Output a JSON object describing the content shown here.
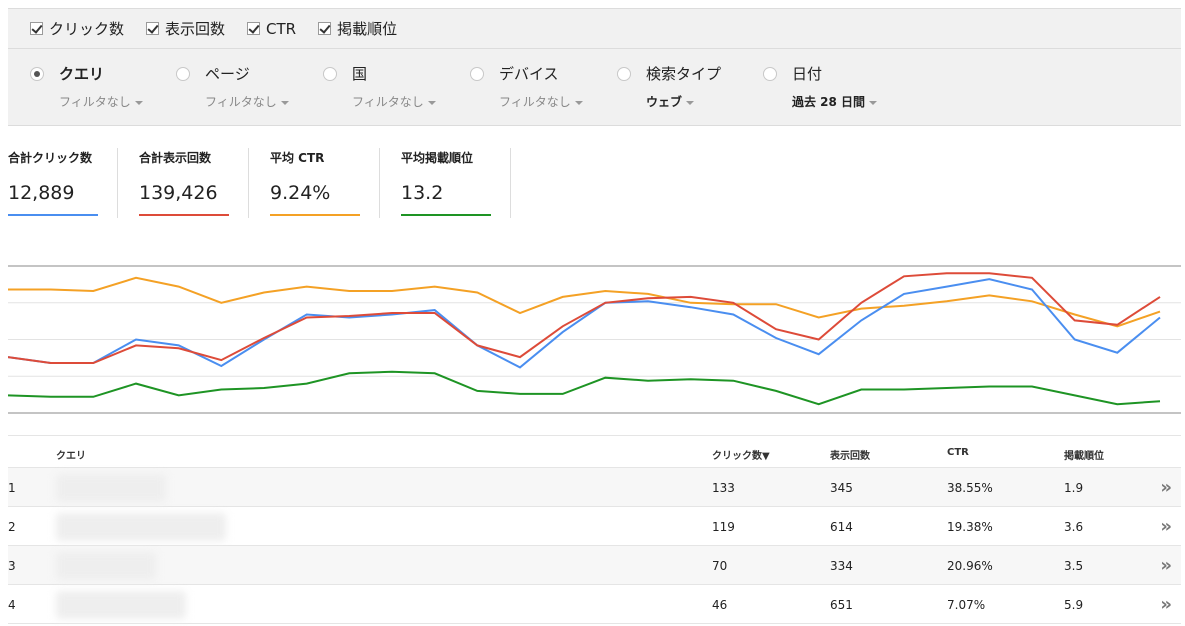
{
  "metric_toggles": [
    {
      "label": "クリック数",
      "checked": true
    },
    {
      "label": "表示回数",
      "checked": true
    },
    {
      "label": "CTR",
      "checked": true
    },
    {
      "label": "掲載順位",
      "checked": true
    }
  ],
  "groups": [
    {
      "label": "クエリ",
      "sub": "フィルタなし",
      "selected": true
    },
    {
      "label": "ページ",
      "sub": "フィルタなし",
      "selected": false
    },
    {
      "label": "国",
      "sub": "フィルタなし",
      "selected": false
    },
    {
      "label": "デバイス",
      "sub": "フィルタなし",
      "selected": false
    },
    {
      "label": "検索タイプ",
      "sub": "ウェブ",
      "selected": false
    },
    {
      "label": "日付",
      "sub": "過去 28 日間",
      "selected": false
    }
  ],
  "totals": [
    {
      "label": "合計クリック数",
      "value": "12,889",
      "color": "#4a8ef0"
    },
    {
      "label": "合計表示回数",
      "value": "139,426",
      "color": "#dd4b39"
    },
    {
      "label": "平均 CTR",
      "value": "9.24%",
      "color": "#f4a125"
    },
    {
      "label": "平均掲載順位",
      "value": "13.2",
      "color": "#1e9424"
    }
  ],
  "chart_data": {
    "type": "line",
    "x": [
      1,
      2,
      3,
      4,
      5,
      6,
      7,
      8,
      9,
      10,
      11,
      12,
      13,
      14,
      15,
      16,
      17,
      18,
      19,
      20,
      21,
      22,
      23,
      24,
      25,
      26,
      27,
      28
    ],
    "series": [
      {
        "color": "#4a8ef0",
        "values": [
          0.38,
          0.34,
          0.34,
          0.5,
          0.46,
          0.32,
          0.5,
          0.67,
          0.65,
          0.67,
          0.7,
          0.46,
          0.31,
          0.55,
          0.75,
          0.76,
          0.72,
          0.67,
          0.51,
          0.4,
          0.63,
          0.81,
          0.86,
          0.91,
          0.84,
          0.5,
          0.41,
          0.65
        ]
      },
      {
        "color": "#dd4b39",
        "values": [
          0.38,
          0.34,
          0.34,
          0.46,
          0.44,
          0.36,
          0.51,
          0.65,
          0.66,
          0.68,
          0.68,
          0.46,
          0.38,
          0.59,
          0.75,
          0.78,
          0.79,
          0.75,
          0.57,
          0.5,
          0.75,
          0.93,
          0.95,
          0.95,
          0.92,
          0.63,
          0.6,
          0.79
        ]
      },
      {
        "color": "#f4a125",
        "values": [
          0.84,
          0.84,
          0.83,
          0.92,
          0.86,
          0.75,
          0.82,
          0.86,
          0.83,
          0.83,
          0.86,
          0.82,
          0.68,
          0.79,
          0.83,
          0.81,
          0.75,
          0.74,
          0.74,
          0.65,
          0.71,
          0.73,
          0.76,
          0.8,
          0.76,
          0.67,
          0.59,
          0.69
        ]
      },
      {
        "color": "#1e9424",
        "values": [
          0.12,
          0.11,
          0.11,
          0.2,
          0.12,
          0.16,
          0.17,
          0.2,
          0.27,
          0.28,
          0.27,
          0.15,
          0.13,
          0.13,
          0.24,
          0.22,
          0.23,
          0.22,
          0.15,
          0.06,
          0.16,
          0.16,
          0.17,
          0.18,
          0.18,
          0.12,
          0.06,
          0.08
        ]
      }
    ]
  },
  "table": {
    "headers": {
      "query": "クエリ",
      "clicks": "クリック数▼",
      "impressions": "表示回数",
      "ctr": "CTR",
      "position": "掲載順位"
    },
    "rows": [
      {
        "rank": "1",
        "clicks": "133",
        "impressions": "345",
        "ctr": "38.55%",
        "position": "1.9"
      },
      {
        "rank": "2",
        "clicks": "119",
        "impressions": "614",
        "ctr": "19.38%",
        "position": "3.6"
      },
      {
        "rank": "3",
        "clicks": "70",
        "impressions": "334",
        "ctr": "20.96%",
        "position": "3.5"
      },
      {
        "rank": "4",
        "clicks": "46",
        "impressions": "651",
        "ctr": "7.07%",
        "position": "5.9"
      }
    ],
    "more_icon": "»"
  }
}
